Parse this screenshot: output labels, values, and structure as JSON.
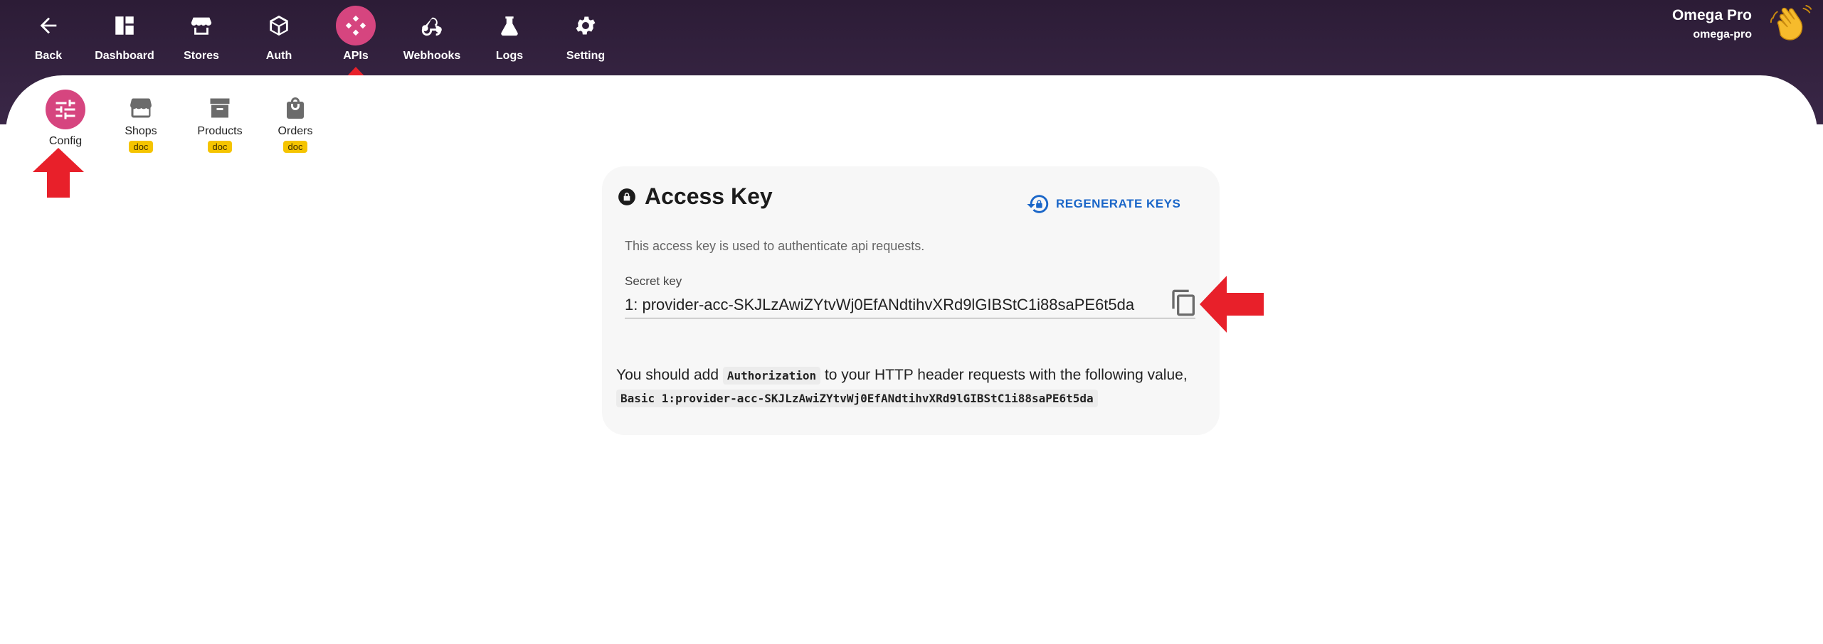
{
  "nav": {
    "items": [
      {
        "label": "Back",
        "icon": "arrow-left-icon"
      },
      {
        "label": "Dashboard",
        "icon": "dashboard-icon"
      },
      {
        "label": "Stores",
        "icon": "store-icon"
      },
      {
        "label": "Auth",
        "icon": "cube-icon"
      },
      {
        "label": "APIs",
        "icon": "api-icon"
      },
      {
        "label": "Webhooks",
        "icon": "webhook-icon"
      },
      {
        "label": "Logs",
        "icon": "flask-icon"
      },
      {
        "label": "Setting",
        "icon": "gear-icon"
      }
    ],
    "active": "APIs"
  },
  "user": {
    "name": "Omega Pro",
    "slug": "omega-pro",
    "avatar": "waving-hand-icon"
  },
  "subnav": {
    "items": [
      {
        "label": "Config",
        "icon": "tune-icon"
      },
      {
        "label": "Shops",
        "icon": "storefront-icon",
        "badge": "doc"
      },
      {
        "label": "Products",
        "icon": "archive-icon",
        "badge": "doc"
      },
      {
        "label": "Orders",
        "icon": "shopping-bag-icon",
        "badge": "doc"
      }
    ],
    "active": "Config"
  },
  "card": {
    "title": "Access Key",
    "regenerate_label": "REGENERATE KEYS",
    "description": "This access key is used to authenticate api requests.",
    "secret_label": "Secret key",
    "secret_value": "1: provider-acc-SKJLzAwiZYtvWj0EfANdtihvXRd9lGIBStC1i88saPE6t5da",
    "auth_prefix": "You should add",
    "auth_header": "Authorization",
    "auth_suffix": "to your HTTP header requests with the following value,",
    "auth_value": "Basic 1:provider-acc-SKJLzAwiZYtvWj0EfANdtihvXRd9lGIBStC1i88saPE6t5da"
  },
  "colors": {
    "topbar": "#2c1c36",
    "active_pink": "#d6457f",
    "link_blue": "#1a66c8",
    "badge_yellow": "#f5c400",
    "annotation_red": "#e8202a"
  }
}
